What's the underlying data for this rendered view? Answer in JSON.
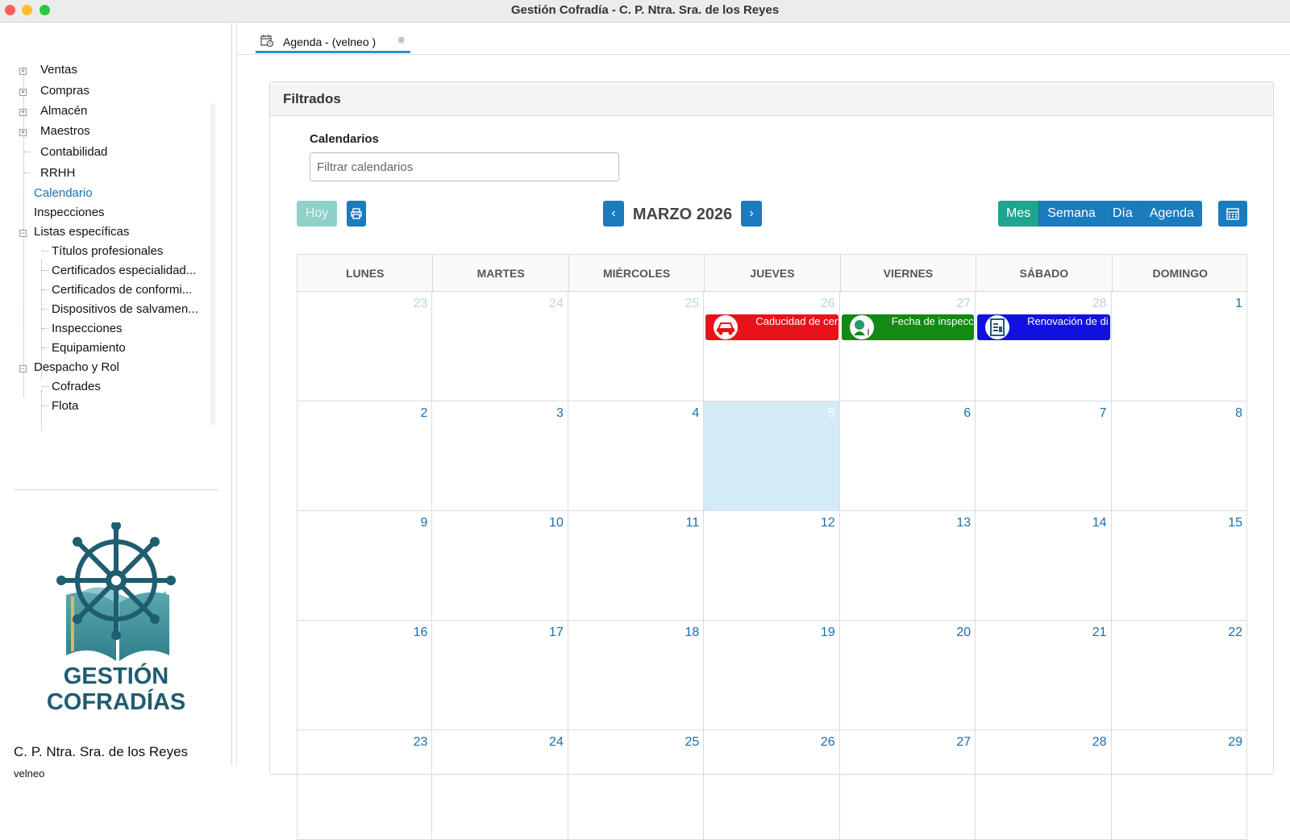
{
  "window": {
    "title": "Gestión Cofradía - C. P. Ntra. Sra. de los Reyes"
  },
  "sidebar": {
    "items": [
      {
        "label": "Ventas"
      },
      {
        "label": "Compras"
      },
      {
        "label": "Almacén"
      },
      {
        "label": "Maestros"
      },
      {
        "label": "Contabilidad"
      },
      {
        "label": "RRHH"
      },
      {
        "label": "Calendario"
      },
      {
        "label": "Inspecciones"
      },
      {
        "label": "Listas específicas"
      },
      {
        "label": "Títulos profesionales"
      },
      {
        "label": "Certificados especialidad..."
      },
      {
        "label": "Certificados de conformi..."
      },
      {
        "label": "Dispositivos de salvamen..."
      },
      {
        "label": "Inspecciones"
      },
      {
        "label": "Equipamiento"
      },
      {
        "label": "Despacho y Rol"
      },
      {
        "label": "Cofrades"
      },
      {
        "label": "Flota"
      }
    ],
    "logo_text_1": "GESTIÓN",
    "logo_text_2": "COFRADÍAS",
    "org_name": "C. P. Ntra. Sra. de los Reyes",
    "user": "velneo"
  },
  "tab": {
    "label": "Agenda - (velneo )"
  },
  "panel": {
    "title": "Filtrados",
    "calendars_label": "Calendarios",
    "filter_placeholder": "Filtrar calendarios"
  },
  "toolbar": {
    "today": "Hoy",
    "prev": "‹",
    "next": "›",
    "month_title": "MARZO 2026",
    "views": [
      "Mes",
      "Semana",
      "Día",
      "Agenda"
    ],
    "active_view": "Mes"
  },
  "calendar": {
    "weekdays": [
      "LUNES",
      "MARTES",
      "MIÉRCOLES",
      "JUEVES",
      "VIERNES",
      "SÁBADO",
      "DOMINGO"
    ],
    "weeks": [
      [
        "23",
        "24",
        "25",
        "26",
        "27",
        "28",
        "1"
      ],
      [
        "2",
        "3",
        "4",
        "5",
        "6",
        "7",
        "8"
      ],
      [
        "9",
        "10",
        "11",
        "12",
        "13",
        "14",
        "15"
      ],
      [
        "16",
        "17",
        "18",
        "19",
        "20",
        "21",
        "22"
      ],
      [
        "23",
        "24",
        "25",
        "26",
        "27",
        "28",
        "29"
      ]
    ],
    "today_day": "5",
    "events": [
      {
        "label": "Caducidad de cer",
        "color": "#e8121b",
        "icon": "car-icon"
      },
      {
        "label": "Fecha de inspecc",
        "color": "#138a13",
        "icon": "inspection-icon"
      },
      {
        "label": "Renovación de di",
        "color": "#1212e0",
        "icon": "document-icon"
      }
    ]
  },
  "colors": {
    "primary": "#1a7bbd",
    "active": "#1fa58f",
    "today_bg": "#d3ebf7"
  }
}
